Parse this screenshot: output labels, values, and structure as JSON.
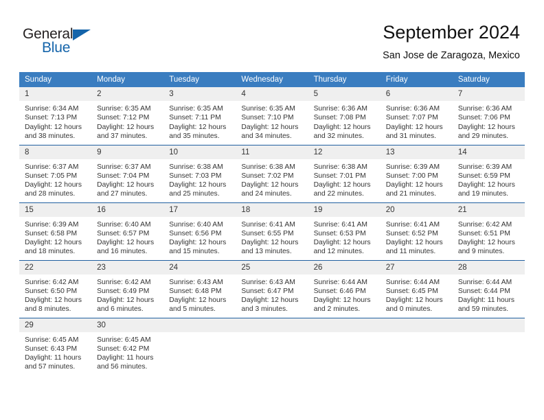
{
  "brand": {
    "name_part1": "General",
    "name_part2": "Blue",
    "accent_color": "#1464aa",
    "triangle_icon": "triangle-icon"
  },
  "header": {
    "title": "September 2024",
    "subtitle": "San Jose de Zaragoza, Mexico"
  },
  "calendar": {
    "header_bg": "#3a7dc0",
    "daynum_bg": "#efefef",
    "separator_color": "#1f5fa0",
    "weekdays": [
      "Sunday",
      "Monday",
      "Tuesday",
      "Wednesday",
      "Thursday",
      "Friday",
      "Saturday"
    ],
    "weeks": [
      [
        {
          "day": "1",
          "sunrise": "Sunrise: 6:34 AM",
          "sunset": "Sunset: 7:13 PM",
          "daylight1": "Daylight: 12 hours",
          "daylight2": "and 38 minutes."
        },
        {
          "day": "2",
          "sunrise": "Sunrise: 6:35 AM",
          "sunset": "Sunset: 7:12 PM",
          "daylight1": "Daylight: 12 hours",
          "daylight2": "and 37 minutes."
        },
        {
          "day": "3",
          "sunrise": "Sunrise: 6:35 AM",
          "sunset": "Sunset: 7:11 PM",
          "daylight1": "Daylight: 12 hours",
          "daylight2": "and 35 minutes."
        },
        {
          "day": "4",
          "sunrise": "Sunrise: 6:35 AM",
          "sunset": "Sunset: 7:10 PM",
          "daylight1": "Daylight: 12 hours",
          "daylight2": "and 34 minutes."
        },
        {
          "day": "5",
          "sunrise": "Sunrise: 6:36 AM",
          "sunset": "Sunset: 7:08 PM",
          "daylight1": "Daylight: 12 hours",
          "daylight2": "and 32 minutes."
        },
        {
          "day": "6",
          "sunrise": "Sunrise: 6:36 AM",
          "sunset": "Sunset: 7:07 PM",
          "daylight1": "Daylight: 12 hours",
          "daylight2": "and 31 minutes."
        },
        {
          "day": "7",
          "sunrise": "Sunrise: 6:36 AM",
          "sunset": "Sunset: 7:06 PM",
          "daylight1": "Daylight: 12 hours",
          "daylight2": "and 29 minutes."
        }
      ],
      [
        {
          "day": "8",
          "sunrise": "Sunrise: 6:37 AM",
          "sunset": "Sunset: 7:05 PM",
          "daylight1": "Daylight: 12 hours",
          "daylight2": "and 28 minutes."
        },
        {
          "day": "9",
          "sunrise": "Sunrise: 6:37 AM",
          "sunset": "Sunset: 7:04 PM",
          "daylight1": "Daylight: 12 hours",
          "daylight2": "and 27 minutes."
        },
        {
          "day": "10",
          "sunrise": "Sunrise: 6:38 AM",
          "sunset": "Sunset: 7:03 PM",
          "daylight1": "Daylight: 12 hours",
          "daylight2": "and 25 minutes."
        },
        {
          "day": "11",
          "sunrise": "Sunrise: 6:38 AM",
          "sunset": "Sunset: 7:02 PM",
          "daylight1": "Daylight: 12 hours",
          "daylight2": "and 24 minutes."
        },
        {
          "day": "12",
          "sunrise": "Sunrise: 6:38 AM",
          "sunset": "Sunset: 7:01 PM",
          "daylight1": "Daylight: 12 hours",
          "daylight2": "and 22 minutes."
        },
        {
          "day": "13",
          "sunrise": "Sunrise: 6:39 AM",
          "sunset": "Sunset: 7:00 PM",
          "daylight1": "Daylight: 12 hours",
          "daylight2": "and 21 minutes."
        },
        {
          "day": "14",
          "sunrise": "Sunrise: 6:39 AM",
          "sunset": "Sunset: 6:59 PM",
          "daylight1": "Daylight: 12 hours",
          "daylight2": "and 19 minutes."
        }
      ],
      [
        {
          "day": "15",
          "sunrise": "Sunrise: 6:39 AM",
          "sunset": "Sunset: 6:58 PM",
          "daylight1": "Daylight: 12 hours",
          "daylight2": "and 18 minutes."
        },
        {
          "day": "16",
          "sunrise": "Sunrise: 6:40 AM",
          "sunset": "Sunset: 6:57 PM",
          "daylight1": "Daylight: 12 hours",
          "daylight2": "and 16 minutes."
        },
        {
          "day": "17",
          "sunrise": "Sunrise: 6:40 AM",
          "sunset": "Sunset: 6:56 PM",
          "daylight1": "Daylight: 12 hours",
          "daylight2": "and 15 minutes."
        },
        {
          "day": "18",
          "sunrise": "Sunrise: 6:41 AM",
          "sunset": "Sunset: 6:55 PM",
          "daylight1": "Daylight: 12 hours",
          "daylight2": "and 13 minutes."
        },
        {
          "day": "19",
          "sunrise": "Sunrise: 6:41 AM",
          "sunset": "Sunset: 6:53 PM",
          "daylight1": "Daylight: 12 hours",
          "daylight2": "and 12 minutes."
        },
        {
          "day": "20",
          "sunrise": "Sunrise: 6:41 AM",
          "sunset": "Sunset: 6:52 PM",
          "daylight1": "Daylight: 12 hours",
          "daylight2": "and 11 minutes."
        },
        {
          "day": "21",
          "sunrise": "Sunrise: 6:42 AM",
          "sunset": "Sunset: 6:51 PM",
          "daylight1": "Daylight: 12 hours",
          "daylight2": "and 9 minutes."
        }
      ],
      [
        {
          "day": "22",
          "sunrise": "Sunrise: 6:42 AM",
          "sunset": "Sunset: 6:50 PM",
          "daylight1": "Daylight: 12 hours",
          "daylight2": "and 8 minutes."
        },
        {
          "day": "23",
          "sunrise": "Sunrise: 6:42 AM",
          "sunset": "Sunset: 6:49 PM",
          "daylight1": "Daylight: 12 hours",
          "daylight2": "and 6 minutes."
        },
        {
          "day": "24",
          "sunrise": "Sunrise: 6:43 AM",
          "sunset": "Sunset: 6:48 PM",
          "daylight1": "Daylight: 12 hours",
          "daylight2": "and 5 minutes."
        },
        {
          "day": "25",
          "sunrise": "Sunrise: 6:43 AM",
          "sunset": "Sunset: 6:47 PM",
          "daylight1": "Daylight: 12 hours",
          "daylight2": "and 3 minutes."
        },
        {
          "day": "26",
          "sunrise": "Sunrise: 6:44 AM",
          "sunset": "Sunset: 6:46 PM",
          "daylight1": "Daylight: 12 hours",
          "daylight2": "and 2 minutes."
        },
        {
          "day": "27",
          "sunrise": "Sunrise: 6:44 AM",
          "sunset": "Sunset: 6:45 PM",
          "daylight1": "Daylight: 12 hours",
          "daylight2": "and 0 minutes."
        },
        {
          "day": "28",
          "sunrise": "Sunrise: 6:44 AM",
          "sunset": "Sunset: 6:44 PM",
          "daylight1": "Daylight: 11 hours",
          "daylight2": "and 59 minutes."
        }
      ],
      [
        {
          "day": "29",
          "sunrise": "Sunrise: 6:45 AM",
          "sunset": "Sunset: 6:43 PM",
          "daylight1": "Daylight: 11 hours",
          "daylight2": "and 57 minutes."
        },
        {
          "day": "30",
          "sunrise": "Sunrise: 6:45 AM",
          "sunset": "Sunset: 6:42 PM",
          "daylight1": "Daylight: 11 hours",
          "daylight2": "and 56 minutes."
        },
        {
          "day": "",
          "sunrise": "",
          "sunset": "",
          "daylight1": "",
          "daylight2": ""
        },
        {
          "day": "",
          "sunrise": "",
          "sunset": "",
          "daylight1": "",
          "daylight2": ""
        },
        {
          "day": "",
          "sunrise": "",
          "sunset": "",
          "daylight1": "",
          "daylight2": ""
        },
        {
          "day": "",
          "sunrise": "",
          "sunset": "",
          "daylight1": "",
          "daylight2": ""
        },
        {
          "day": "",
          "sunrise": "",
          "sunset": "",
          "daylight1": "",
          "daylight2": ""
        }
      ]
    ]
  }
}
